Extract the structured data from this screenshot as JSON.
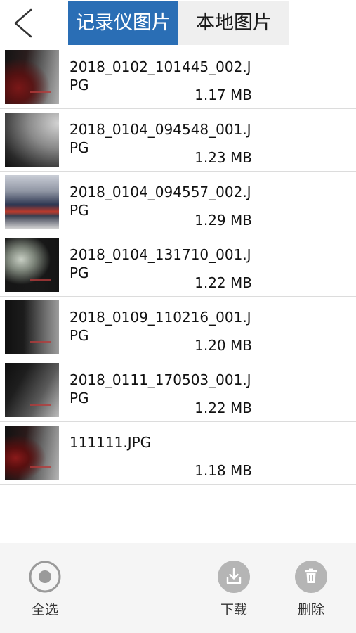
{
  "header": {
    "tabs": [
      {
        "label": "记录仪图片",
        "active": true
      },
      {
        "label": "本地图片",
        "active": false
      }
    ],
    "accent_color": "#2a6eb5"
  },
  "files": [
    {
      "name": "2018_0102_101445_002.JPG",
      "size": "1.17 MB"
    },
    {
      "name": "2018_0104_094548_001.JPG",
      "size": "1.23 MB"
    },
    {
      "name": "2018_0104_094557_002.JPG",
      "size": "1.29 MB"
    },
    {
      "name": "2018_0104_131710_001.JPG",
      "size": "1.22 MB"
    },
    {
      "name": "2018_0109_110216_001.JPG",
      "size": "1.20 MB"
    },
    {
      "name": "2018_0111_170503_001.JPG",
      "size": "1.22 MB"
    },
    {
      "name": "111111.JPG",
      "size": "1.18 MB"
    }
  ],
  "toolbar": {
    "select_all_label": "全选",
    "download_label": "下载",
    "delete_label": "删除"
  }
}
